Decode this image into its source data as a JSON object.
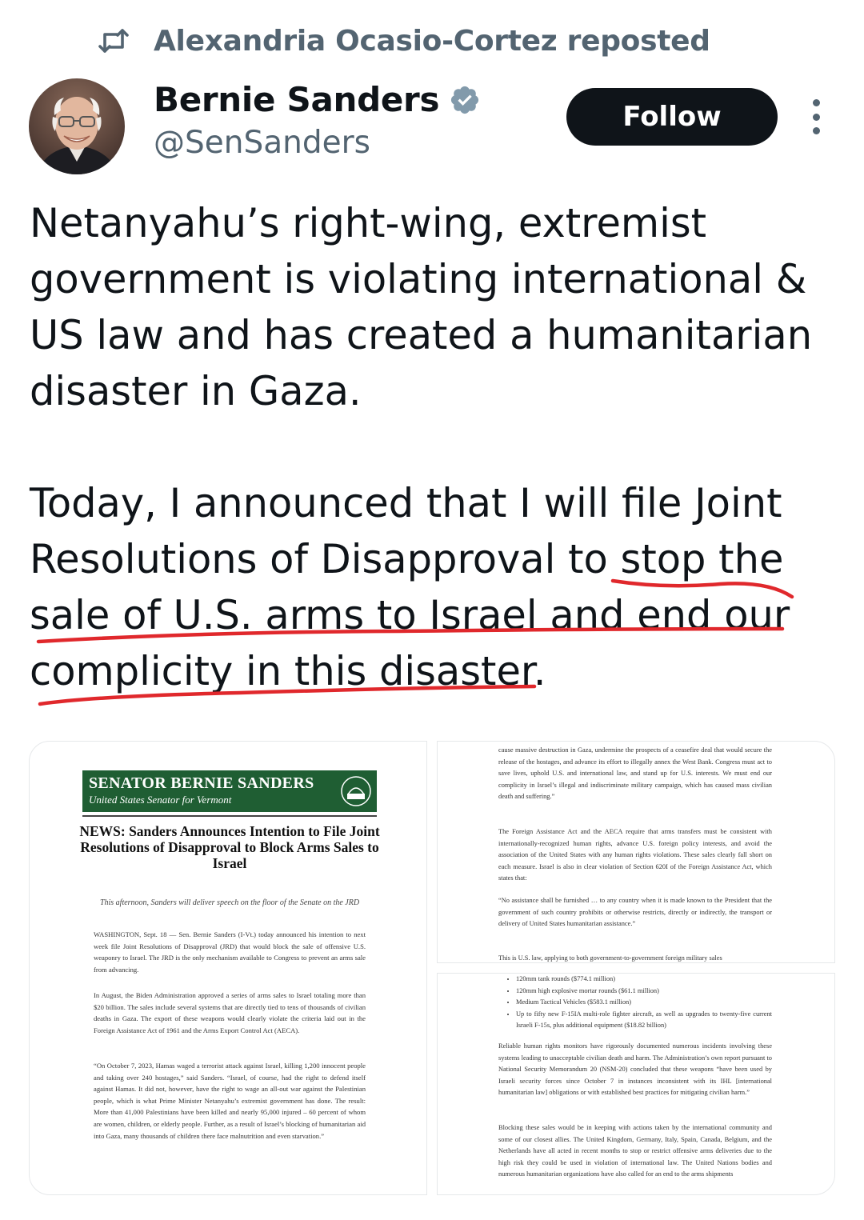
{
  "repost": {
    "text": "Alexandria Ocasio-Cortez reposted",
    "icon": "repost-icon"
  },
  "author": {
    "name": "Bernie Sanders",
    "handle": "@SenSanders",
    "verified_icon": "verified-badge-icon",
    "badge_color": "#829aab"
  },
  "follow_label": "Follow",
  "tweet": {
    "paragraph1": [
      "Netanyahu’s right-wing, extremist",
      "government is violating international &",
      "US law and has created a humanitarian",
      "disaster in Gaza."
    ],
    "paragraph2": [
      "Today, I announced that I will file Joint",
      "Resolutions of Disapproval to stop the",
      "sale of U.S. arms to Israel and end our",
      "complicity in this disaster."
    ]
  },
  "colors": {
    "text": "#0f1419",
    "secondary": "#536471",
    "follow_bg": "#0f1419",
    "underline": "#e0282c",
    "banner": "#1f5e33"
  },
  "press_release": {
    "banner_title": "SENATOR BERNIE SANDERS",
    "banner_subtitle": "United States Senator for Vermont",
    "seal_text": "BERNIE",
    "headline": "NEWS: Sanders Announces Intention to File Joint Resolutions of Disapproval to Block Arms Sales to Israel",
    "italic": "This afternoon, Sanders will deliver speech on the floor of the Senate on the JRD",
    "para1": "WASHINGTON, Sept. 18 — Sen. Bernie Sanders (I-Vt.) today announced his intention to next week file Joint Resolutions of Disapproval (JRD) that would block the sale of offensive U.S. weaponry to Israel. The JRD is the only mechanism available to Congress to prevent an arms sale from advancing.",
    "para2": "In August, the Biden Administration approved a series of arms sales to Israel totaling more than $20 billion. The sales include several systems that are directly tied to tens of thousands of civilian deaths in Gaza. The export of these weapons would clearly violate the criteria laid out in the Foreign Assistance Act of 1961 and the Arms Export Control Act (AECA).",
    "para3": "“On October 7, 2023, Hamas waged a terrorist attack against Israel, killing 1,200 innocent people and taking over 240 hostages,” said Sanders. “Israel, of course, had the right to defend itself against Hamas. It did not, however, have the right to wage an all-out war against the Palestinian people, which is what Prime Minister Netanyahu’s extremist government has done. The result: More than 41,000 Palestinians have been killed and nearly 95,000 injured – 60 percent of whom are women, children, or elderly people. Further, as a result of Israel’s blocking of humanitarian aid into Gaza, many thousands of children there face malnutrition and even starvation.”"
  },
  "page2": {
    "para1": "cause massive destruction in Gaza, undermine the prospects of a ceasefire deal that would secure the release of the hostages, and advance its effort to illegally annex the West Bank. Congress must act to save lives, uphold U.S. and international law, and stand up for U.S. interests. We must end our complicity in Israel’s illegal and indiscriminate military campaign, which has caused mass civilian death and suffering.”",
    "para2": "The Foreign Assistance Act and the AECA require that arms transfers must be consistent with internationally-recognized human rights, advance U.S. foreign policy interests, and avoid the association of the United States with any human rights violations. These sales clearly fall short on each measure. Israel is also in clear violation of Section 620I of the Foreign Assistance Act, which states that:",
    "quote": "“No assistance shall be furnished … to any country when it is made known to the President that the government of such country prohibits or otherwise restricts, directly or indirectly, the transport or delivery of United States humanitarian assistance.”",
    "para3": "This is U.S. law, applying to both government-to-government foreign military sales"
  },
  "page3": {
    "bullets": [
      "120mm tank rounds ($774.1 million)",
      "120mm high explosive mortar rounds ($61.1 million)",
      "Medium Tactical Vehicles ($583.1 million)",
      "Up to fifty new F-15IA multi-role fighter aircraft, as well as upgrades to twenty-five current Israeli F-15s, plus additional equipment ($18.82 billion)"
    ],
    "para1": "Reliable human rights monitors have rigorously documented numerous incidents involving these systems leading to unacceptable civilian death and harm. The Administration’s own report pursuant to National Security Memorandum 20 (NSM-20) concluded that these weapons “have been used by Israeli security forces since October 7 in instances inconsistent with its IHL [international humanitarian law] obligations or with established best practices for mitigating civilian harm.”",
    "para2": "Blocking these sales would be in keeping with actions taken by the international community and some of our closest allies. The United Kingdom, Germany, Italy, Spain, Canada, Belgium, and the Netherlands have all acted in recent months to stop or restrict offensive arms deliveries due to the high risk they could be used in violation of international law. The United Nations bodies and numerous humanitarian organizations have also called for an end to the arms shipments"
  }
}
